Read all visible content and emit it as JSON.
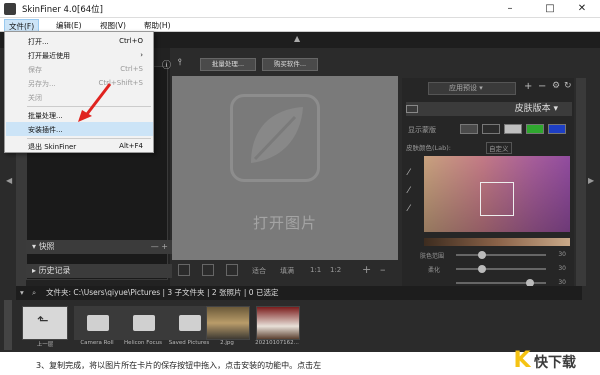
{
  "window": {
    "title": "SkinFiner 4.0[64位]",
    "controls": {
      "minimize": "–",
      "maximize": "□",
      "close": "✕"
    }
  },
  "menubar": {
    "items": [
      "文件(F)",
      "编辑(E)",
      "视图(V)",
      "帮助(H)"
    ]
  },
  "file_menu": {
    "items": [
      {
        "label": "打开...",
        "shortcut": "Ctrl+O"
      },
      {
        "label": "打开最近使用",
        "shortcut": "›"
      },
      {
        "label": "保存",
        "shortcut": "Ctrl+S"
      },
      {
        "label": "另存为...",
        "shortcut": "Ctrl+Shift+S"
      },
      {
        "label": "关闭",
        "shortcut": ""
      },
      {
        "label": "批量处理...",
        "shortcut": ""
      },
      {
        "label": "安装插件...",
        "shortcut": ""
      },
      {
        "label": "退出 SkinFiner",
        "shortcut": "Alt+F4"
      }
    ]
  },
  "toolbar": {
    "batch_button": "批量处理...",
    "buy_button": "购买软件..."
  },
  "left_panel": {
    "snapshot_label": "快照",
    "history_label": "历史记录",
    "snapshot_controls": "— +"
  },
  "canvas": {
    "placeholder_text": "打开图片"
  },
  "view_bar": {
    "fit_label": "适合",
    "fill_label": "填满",
    "ratio_label": "1:1",
    "half_label": "1:2"
  },
  "right_panel": {
    "preset_label": "应用预设",
    "skin_version_label": "皮肤版本",
    "show_mask_label": "显示蒙版",
    "skin_color_label": "皮肤颜色(Lab):",
    "custom_label": "自定义",
    "sliders": [
      {
        "label": "肤色范围",
        "value": "30"
      },
      {
        "label": "柔化",
        "value": "30"
      },
      {
        "label": "",
        "value": "30"
      }
    ],
    "swatch_colors": [
      "#4a4a4a",
      "#2c2c2c",
      "#bfbfbf",
      "#2fa72f",
      "#1e3fc4"
    ]
  },
  "file_bar": {
    "path_text": "文件夹: C:\\Users\\qiyue\\Pictures | 3 子文件夹 | 2 张照片 | 0 已选定"
  },
  "filmstrip": {
    "items": [
      {
        "label": "上一层"
      },
      {
        "label": "Camera Roll"
      },
      {
        "label": "Helicon Focus"
      },
      {
        "label": "Saved Pictures"
      },
      {
        "label": "2.jpg"
      },
      {
        "label": "20210107162..."
      }
    ]
  },
  "bottom_text": "3、复制完成，将以图片所在卡片的保存按钮中拖入，点击安装的功能中。点击左",
  "watermark": {
    "k": "K",
    "text": "快下载"
  }
}
